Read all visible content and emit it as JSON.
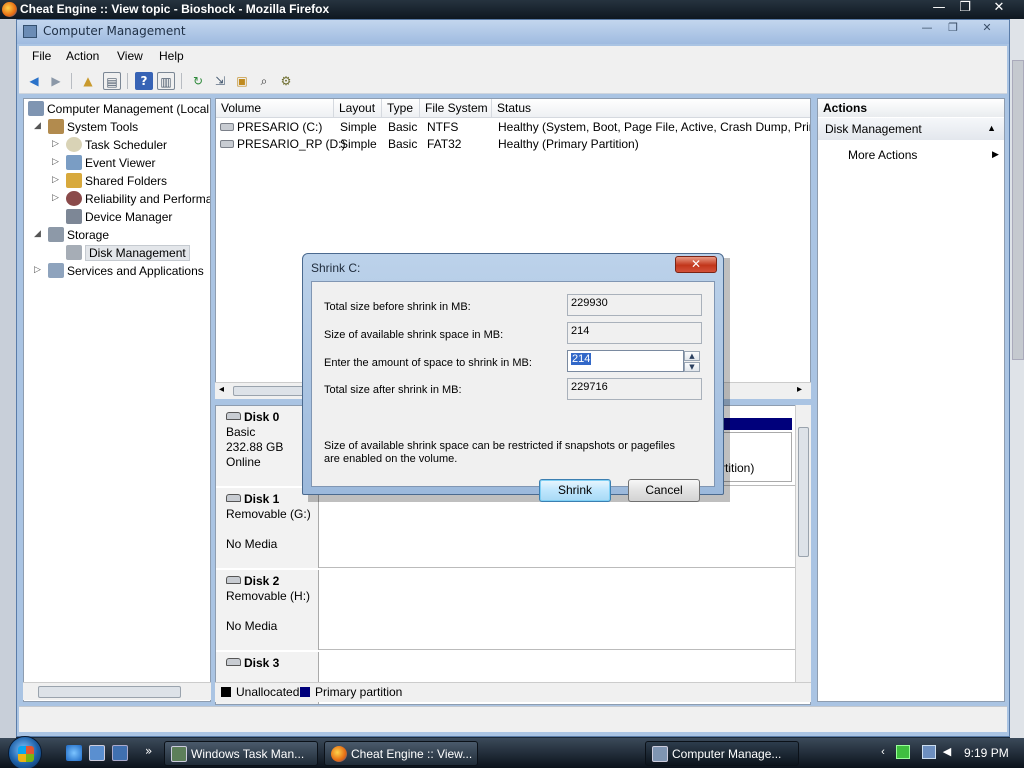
{
  "firefox": {
    "title": "Cheat Engine :: View topic - Bioshock - Mozilla Firefox",
    "ctrl_minimize": "—",
    "ctrl_restore": "❐",
    "ctrl_close": "✕"
  },
  "window": {
    "title": "Computer Management",
    "ctrl_minimize": "—",
    "ctrl_restore": "❐",
    "ctrl_close": "✕"
  },
  "menu": {
    "file": "File",
    "action": "Action",
    "view": "View",
    "help": "Help"
  },
  "toolbar": {
    "back": "◀",
    "forward": "▶",
    "up": "▲",
    "show_hide": "▤",
    "help": "?",
    "properties": "▥",
    "refresh": "↻",
    "export": "⇲",
    "open": "▣",
    "search": "⌕",
    "settings": "⚙"
  },
  "tree": {
    "root": "Computer Management (Local",
    "system_tools": "System Tools",
    "task_scheduler": "Task Scheduler",
    "event_viewer": "Event Viewer",
    "shared_folders": "Shared Folders",
    "reliability": "Reliability and Performa",
    "device_manager": "Device Manager",
    "storage": "Storage",
    "disk_management": "Disk Management",
    "services": "Services and Applications",
    "expand_open": "◢",
    "expand_closed": "▷"
  },
  "volumes": {
    "columns": [
      "Volume",
      "Layout",
      "Type",
      "File System",
      "Status"
    ],
    "rows": [
      {
        "volume": "PRESARIO (C:)",
        "layout": "Simple",
        "type": "Basic",
        "fs": "NTFS",
        "status": "Healthy (System, Boot, Page File, Active, Crash Dump, Prim"
      },
      {
        "volume": "PRESARIO_RP (D:)",
        "layout": "Simple",
        "type": "Basic",
        "fs": "FAT32",
        "status": "Healthy (Primary Partition)"
      }
    ],
    "scroll_left": "◂",
    "scroll_right": "▸"
  },
  "disks": [
    {
      "name": "Disk 0",
      "type": "Basic",
      "size": "232.88 GB",
      "state": "Online"
    },
    {
      "name": "Disk 1",
      "type": "Removable (G:)",
      "size": "",
      "state": "No Media"
    },
    {
      "name": "Disk 2",
      "type": "Removable (H:)",
      "size": "",
      "state": "No Media"
    },
    {
      "name": "Disk 3",
      "type": "",
      "size": "",
      "state": ""
    }
  ],
  "disk0_partition_text": "rtition)",
  "legend": {
    "unallocated": "Unallocated",
    "primary": "Primary partition",
    "unallocated_color": "#000000",
    "primary_color": "#00007b"
  },
  "actions": {
    "header": "Actions",
    "section": "Disk Management",
    "section_arrow": "▲",
    "more": "More Actions",
    "more_arrow": "▶"
  },
  "dialog": {
    "title": "Shrink C:",
    "close": "✕",
    "total_before_label": "Total size before shrink in MB:",
    "total_before_value": "229930",
    "available_label": "Size of available shrink space in MB:",
    "available_value": "214",
    "enter_label": "Enter the amount of space to shrink in MB:",
    "enter_value": "214",
    "total_after_label": "Total size after shrink in MB:",
    "total_after_value": "229716",
    "note_line1": "Size of available shrink space can be restricted if snapshots or pagefiles",
    "note_line2": "are enabled on the volume.",
    "shrink_button": "Shrink",
    "cancel_button": "Cancel",
    "spin_up": "▲",
    "spin_down": "▼"
  },
  "taskbar": {
    "more_arrow": "»",
    "buttons": [
      {
        "label": "Windows Task Man..."
      },
      {
        "label": "Cheat Engine :: View..."
      },
      {
        "label": "Computer Manage..."
      }
    ],
    "tray_arrow": "‹",
    "clock": "9:19 PM"
  },
  "colors": {
    "window_frame": "#aac4e3",
    "selection": "#3268c8",
    "dialog_close": "#c2361b"
  }
}
